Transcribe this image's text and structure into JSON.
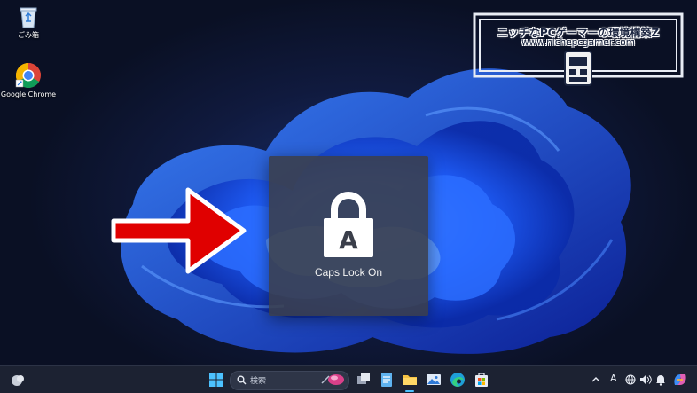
{
  "desktop": {
    "icons": [
      {
        "label": "ごみ箱",
        "icon": "recycle-bin-icon"
      },
      {
        "label": "Google Chrome",
        "icon": "chrome-icon"
      }
    ]
  },
  "osd": {
    "caption": "Caps Lock On",
    "lock_letter": "A"
  },
  "watermark": {
    "title": "ニッチなPCゲーマーの環境構築Z",
    "url": "www.nichepcgamer.com"
  },
  "taskbar": {
    "search_placeholder": "検索",
    "tray": {
      "ime_label": "A"
    },
    "pinned": [
      "start-icon",
      "task-view-icon",
      "notepad-icon",
      "file-explorer-icon",
      "photos-icon",
      "edge-icon",
      "store-icon"
    ]
  },
  "colors": {
    "accent_blue": "#1f5fff",
    "arrow_red": "#e00000",
    "osd_bg": "#3a3e4a",
    "taskbar_bg": "#1c2232"
  }
}
